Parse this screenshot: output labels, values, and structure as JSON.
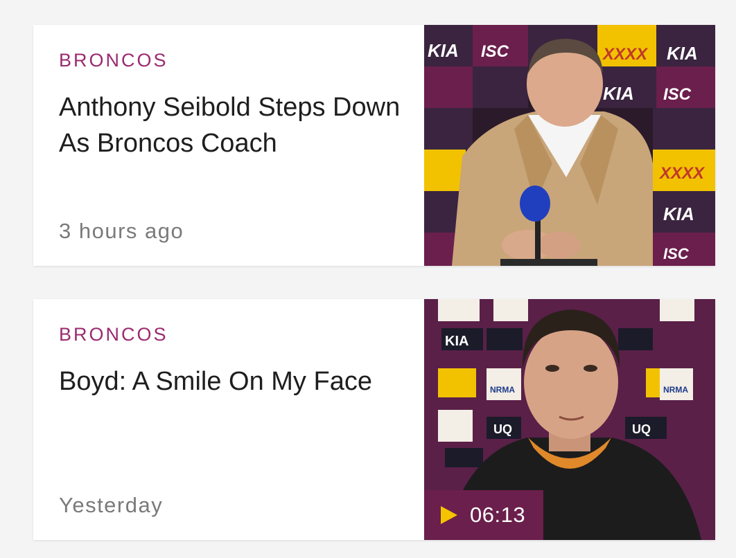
{
  "articles": [
    {
      "category": "BRONCOS",
      "headline": "Anthony Seibold Steps Down As Broncos Coach",
      "time": "3 hours ago",
      "image": "coach-press-conference-photo"
    },
    {
      "category": "BRONCOS",
      "headline": "Boyd: A Smile On My Face",
      "time": "Yesterday",
      "image": "player-interview-video-still",
      "video": {
        "icon": "play-icon",
        "duration": "06:13"
      }
    }
  ],
  "colors": {
    "category": "#9b2a6f",
    "badge": "#6b1f4c",
    "play": "#f5c400"
  },
  "sponsor_boards": {
    "kia": "KIA",
    "isc": "ISC",
    "xxxx": "XXXX",
    "uq": "UQ",
    "nrma": "NRMA"
  }
}
